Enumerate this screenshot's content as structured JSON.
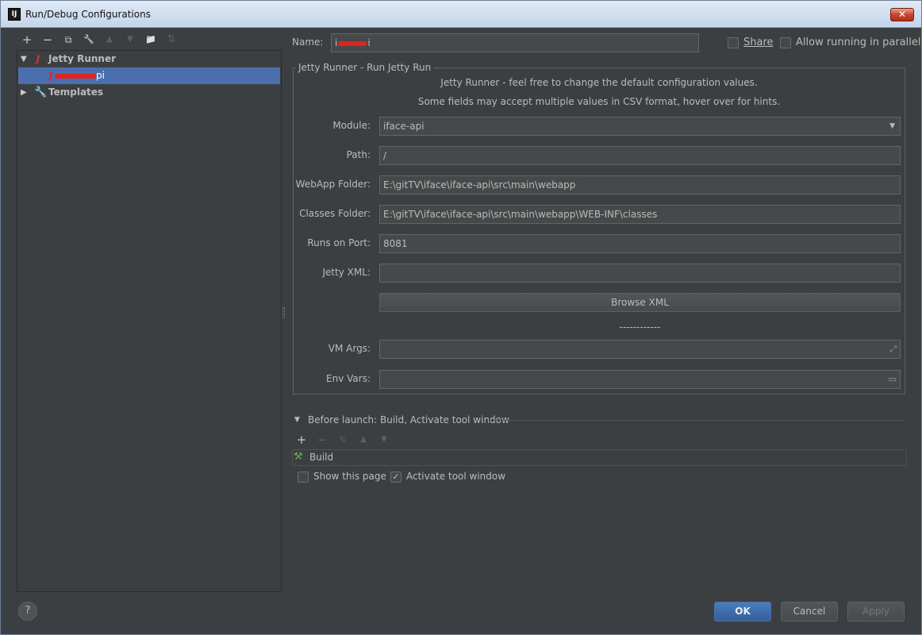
{
  "window": {
    "title": "Run/Debug Configurations",
    "app_icon": "IJ",
    "close_symbol": "✕"
  },
  "left_toolbar": {
    "add": "+",
    "remove": "−",
    "copy": "⧉",
    "edit_defaults": "🔧",
    "move_up": "▲",
    "move_down": "▼",
    "new_folder": "📁",
    "sort": "⇅"
  },
  "tree": {
    "group_label": "Jetty Runner",
    "group_icon": "J",
    "selected_item_suffix": "pi",
    "templates_label": "Templates"
  },
  "form": {
    "name_label": "Name:",
    "name_value_prefix": "i",
    "name_value_suffix": "i",
    "share_label": "Share",
    "allow_parallel_label": "Allow running in parallel",
    "group_title": "Jetty Runner - Run Jetty Run",
    "info_line1": "Jetty Runner - feel free to change the default configuration values.",
    "info_line2": "Some fields may accept multiple values in CSV format, hover over for hints.",
    "module_label": "Module:",
    "module_value": "iface-api",
    "path_label": "Path:",
    "path_value": "/",
    "webapp_label": "WebApp Folder:",
    "webapp_value": "E:\\gitTV\\iface\\iface-api\\src\\main\\webapp",
    "classes_label": "Classes Folder:",
    "classes_value": "E:\\gitTV\\iface\\iface-api\\src\\main\\webapp\\WEB-INF\\classes",
    "port_label": "Runs on Port:",
    "port_value": "8081",
    "jetty_xml_label": "Jetty XML:",
    "jetty_xml_value": "",
    "browse_xml": "Browse XML",
    "separator": "------------",
    "vm_args_label": "VM Args:",
    "vm_args_value": "",
    "env_vars_label": "Env Vars:",
    "env_vars_value": ""
  },
  "before_launch": {
    "title": "Before launch: Build, Activate tool window",
    "add": "+",
    "remove": "−",
    "edit": "✎",
    "up": "▲",
    "down": "▼",
    "task": "Build",
    "show_page_label": "Show this page",
    "show_page_checked": false,
    "activate_label": "Activate tool window",
    "activate_checked": true
  },
  "buttons": {
    "help": "?",
    "ok": "OK",
    "cancel": "Cancel",
    "apply": "Apply"
  }
}
